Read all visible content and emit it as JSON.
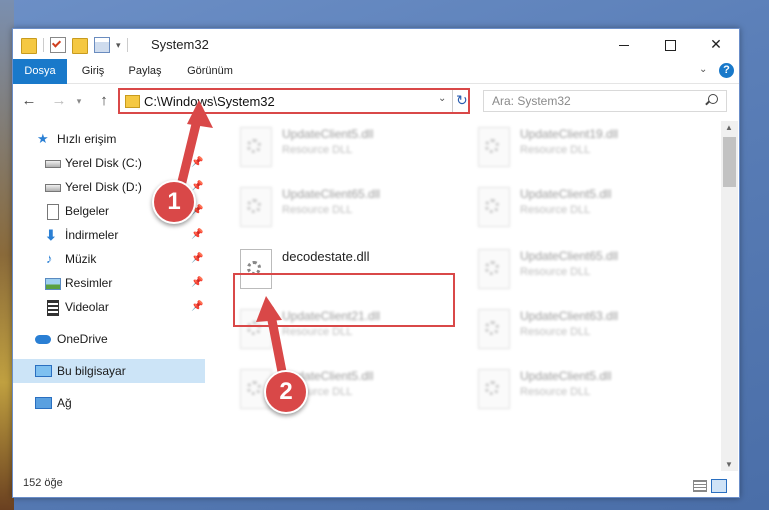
{
  "window": {
    "title": "System32"
  },
  "ribbon": {
    "tabs": [
      "Dosya",
      "Giriş",
      "Paylaş",
      "Görünüm"
    ],
    "help": "?"
  },
  "address": {
    "path": "C:\\Windows\\System32",
    "search_placeholder": "Ara: System32"
  },
  "sidebar": {
    "items": [
      {
        "label": "Hızlı erişim",
        "icon": "star-icon"
      },
      {
        "label": "Yerel Disk (C:)",
        "icon": "drive-icon"
      },
      {
        "label": "Yerel Disk (D:)",
        "icon": "drive-icon"
      },
      {
        "label": "Belgeler",
        "icon": "documents-icon"
      },
      {
        "label": "İndirmeler",
        "icon": "download-icon"
      },
      {
        "label": "Müzik",
        "icon": "music-icon"
      },
      {
        "label": "Resimler",
        "icon": "pictures-icon"
      },
      {
        "label": "Videolar",
        "icon": "video-icon"
      },
      {
        "label": "OneDrive",
        "icon": "cloud-icon"
      },
      {
        "label": "Bu bilgisayar",
        "icon": "computer-icon"
      },
      {
        "label": "Ağ",
        "icon": "network-icon"
      }
    ]
  },
  "files": [
    {
      "name": "UpdateClient5.dll",
      "type": "Resource DLL"
    },
    {
      "name": "UpdateClient19.dll",
      "type": "Resource DLL"
    },
    {
      "name": "UpdateClient65.dll",
      "type": "Resource DLL"
    },
    {
      "name": "UpdateClient5.dll",
      "type": "Resource DLL"
    },
    {
      "name": "decodestate.dll",
      "type": ""
    },
    {
      "name": "UpdateClient65.dll",
      "type": "Resource DLL"
    },
    {
      "name": "UpdateClient21.dll",
      "type": "Resource DLL"
    },
    {
      "name": "UpdateClient63.dll",
      "type": "Resource DLL"
    },
    {
      "name": "UpdateClient5.dll",
      "type": "Resource DLL"
    },
    {
      "name": "UpdateClient5.dll",
      "type": "Resource DLL"
    }
  ],
  "status": {
    "count": "152 öğe"
  },
  "annotations": {
    "step1": "1",
    "step2": "2",
    "color": "#d94848"
  }
}
